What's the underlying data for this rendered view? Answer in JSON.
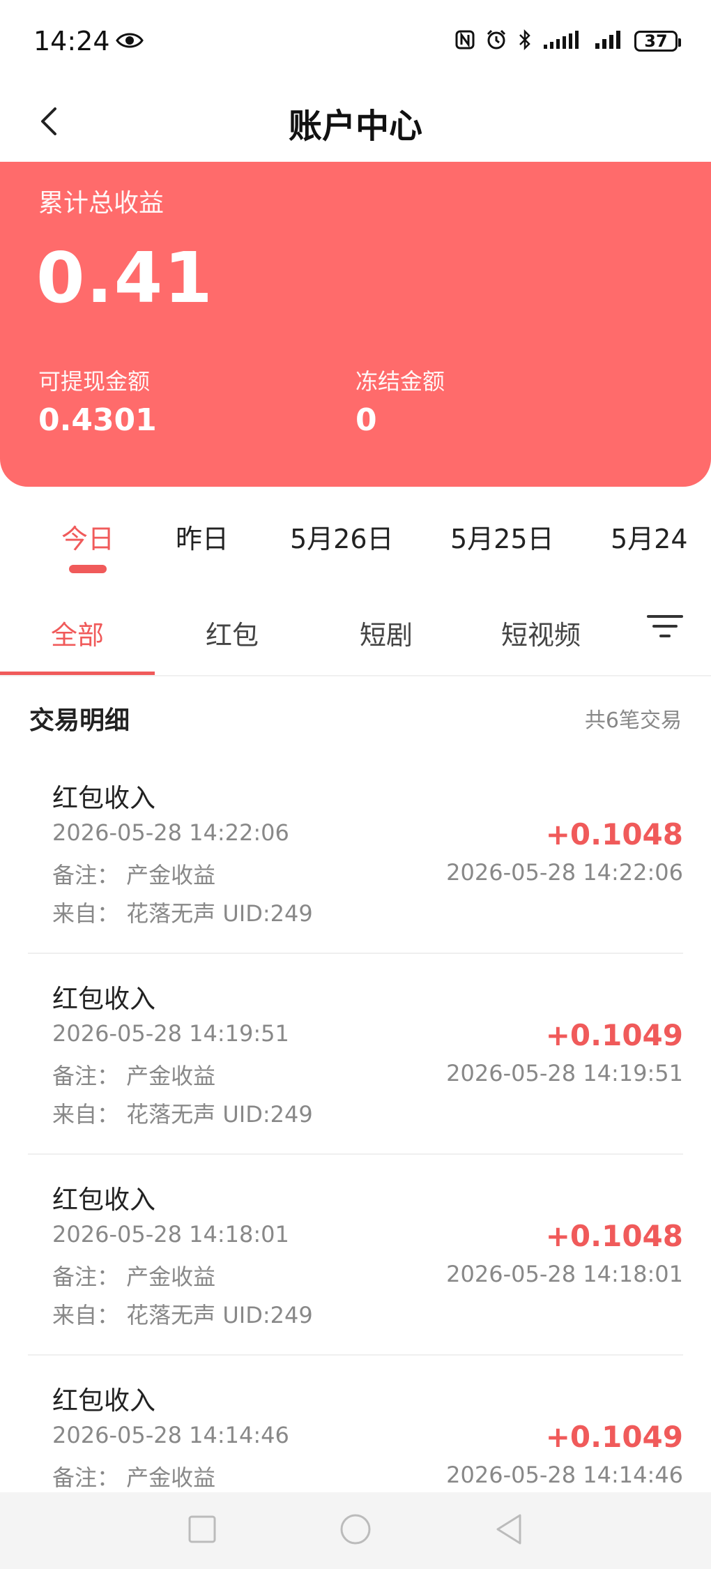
{
  "status_bar": {
    "time": "14:24",
    "battery": "37",
    "icons": [
      "eye-icon",
      "nfc-icon",
      "alarm-icon",
      "bluetooth-icon",
      "signal-icon",
      "signal-icon",
      "battery-icon"
    ]
  },
  "header": {
    "title": "账户中心",
    "back_icon": "chevron-left-icon"
  },
  "summary": {
    "total_label": "累计总收益",
    "total_value": "0.41",
    "withdrawable_label": "可提现金额",
    "withdrawable_value": "0.4301",
    "frozen_label": "冻结金额",
    "frozen_value": "0",
    "accent_color": "#ff6b6b"
  },
  "date_tabs": [
    {
      "label": "今日",
      "active": true
    },
    {
      "label": "昨日",
      "active": false
    },
    {
      "label": "5月26日",
      "active": false
    },
    {
      "label": "5月25日",
      "active": false
    },
    {
      "label": "5月24",
      "active": false
    }
  ],
  "category_tabs": [
    {
      "label": "全部",
      "active": true
    },
    {
      "label": "红包",
      "active": false
    },
    {
      "label": "短剧",
      "active": false
    },
    {
      "label": "短视频",
      "active": false
    }
  ],
  "filter_icon": "filter-icon",
  "details": {
    "title": "交易明细",
    "count_text": "共6笔交易"
  },
  "transactions": [
    {
      "title": "红包收入",
      "time": "2026-05-28 14:22:06",
      "note": "备注：  产金收益",
      "from": "来自：  花落无声 UID:249",
      "amount": "+0.1048",
      "time_right": "2026-05-28 14:22:06"
    },
    {
      "title": "红包收入",
      "time": "2026-05-28 14:19:51",
      "note": "备注：  产金收益",
      "from": "来自：  花落无声 UID:249",
      "amount": "+0.1049",
      "time_right": "2026-05-28 14:19:51"
    },
    {
      "title": "红包收入",
      "time": "2026-05-28 14:18:01",
      "note": "备注：  产金收益",
      "from": "来自：  花落无声 UID:249",
      "amount": "+0.1048",
      "time_right": "2026-05-28 14:18:01"
    },
    {
      "title": "红包收入",
      "time": "2026-05-28 14:14:46",
      "note": "备注：  产金收益",
      "from": "",
      "amount": "+0.1049",
      "time_right": "2026-05-28 14:14:46"
    }
  ],
  "bottom_nav": [
    "square-icon",
    "circle-icon",
    "triangle-back-icon"
  ]
}
